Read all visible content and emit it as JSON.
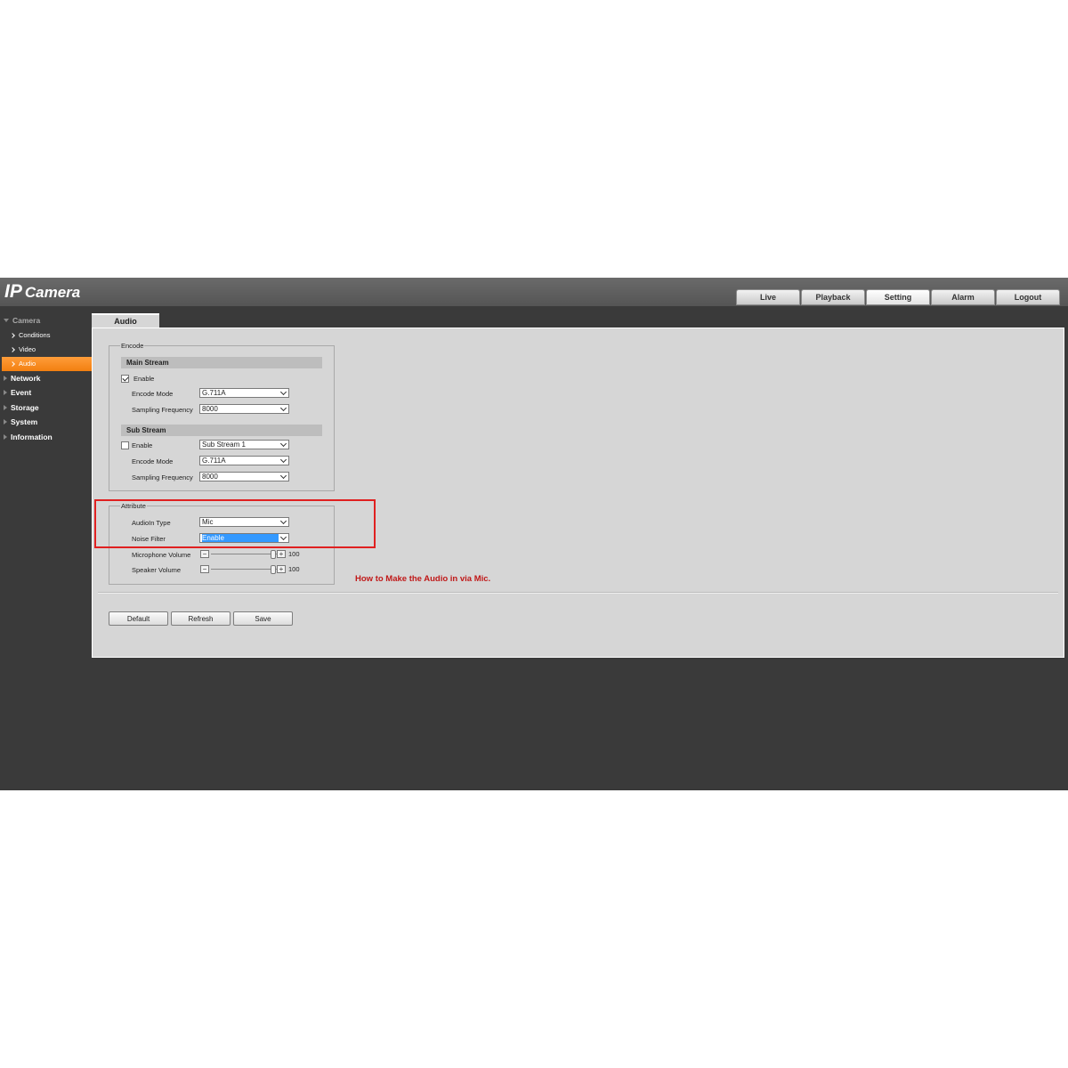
{
  "app": {
    "logo_ip": "IP",
    "logo_camera": "Camera"
  },
  "tabs": [
    {
      "label": "Live"
    },
    {
      "label": "Playback"
    },
    {
      "label": "Setting",
      "active": true
    },
    {
      "label": "Alarm"
    },
    {
      "label": "Logout"
    }
  ],
  "sidebar": {
    "camera": "Camera",
    "conditions": "Conditions",
    "video": "Video",
    "audio": "Audio",
    "network": "Network",
    "event": "Event",
    "storage": "Storage",
    "system": "System",
    "information": "Information"
  },
  "page": {
    "tab": "Audio"
  },
  "encode": {
    "legend": "Encode",
    "main_stream": {
      "title": "Main Stream",
      "enable_label": "Enable",
      "enabled": true,
      "encode_mode_label": "Encode Mode",
      "encode_mode": "G.711A",
      "sampling_label": "Sampling Frequency",
      "sampling": "8000"
    },
    "sub_stream": {
      "title": "Sub Stream",
      "enable_label": "Enable",
      "enabled": false,
      "stream_select": "Sub Stream 1",
      "encode_mode_label": "Encode Mode",
      "encode_mode": "G.711A",
      "sampling_label": "Sampling Frequency",
      "sampling": "8000"
    }
  },
  "attribute": {
    "legend": "Attribute",
    "audioin_label": "AudioIn Type",
    "audioin": "Mic",
    "noise_label": "Noise Filter",
    "noise": "Enable",
    "mic_volume_label": "Microphone Volume",
    "mic_volume": "100",
    "speaker_volume_label": "Speaker Volume",
    "speaker_volume": "100",
    "minus": "−",
    "plus": "+"
  },
  "annotation": {
    "text": "How to Make the Audio in via Mic.",
    "color": "#e02020"
  },
  "buttons": {
    "default": "Default",
    "refresh": "Refresh",
    "save": "Save"
  },
  "colors": {
    "accent": "#f58a1f",
    "highlight": "#3399ff"
  }
}
